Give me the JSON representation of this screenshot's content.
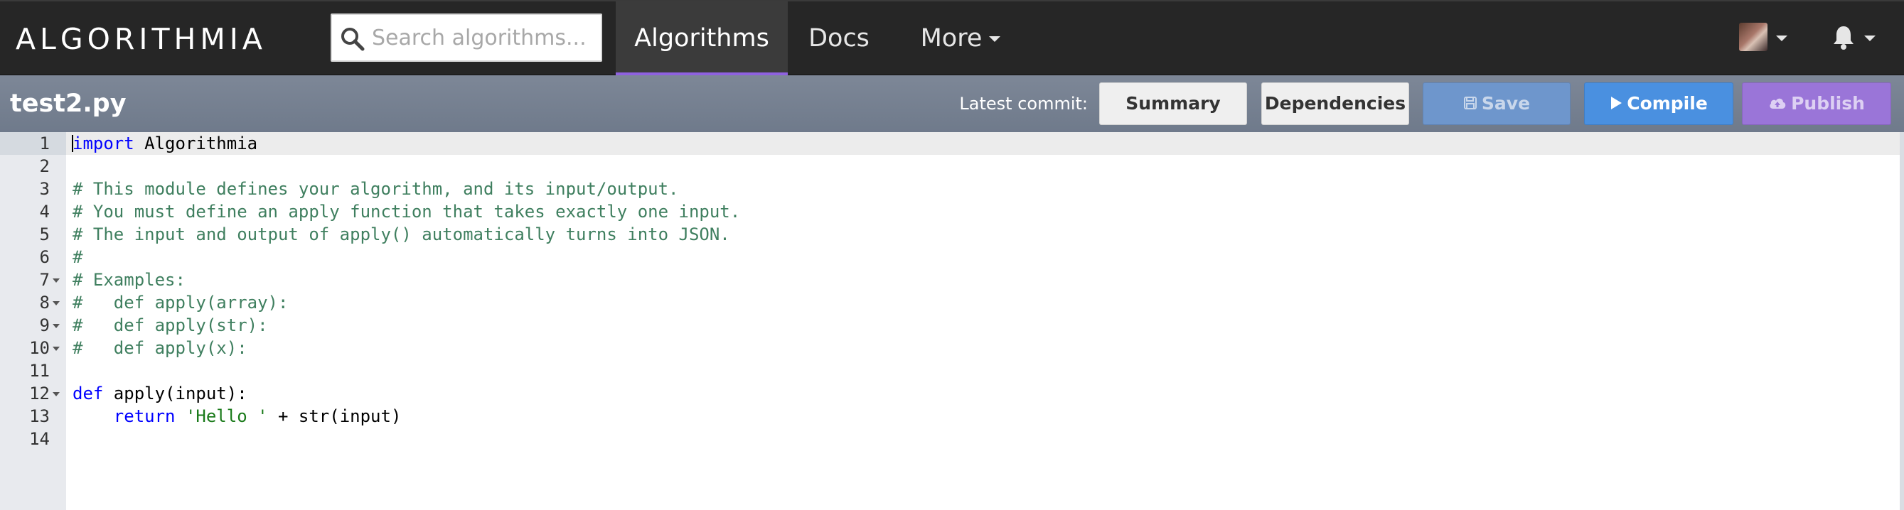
{
  "navbar": {
    "logo_text": "ALGORITHMIA",
    "search_placeholder": "Search algorithms...",
    "nav_items": [
      {
        "label": "Algorithms",
        "active": true
      },
      {
        "label": "Docs",
        "active": false
      },
      {
        "label": "More",
        "active": false
      }
    ],
    "icons": [
      "search-icon",
      "avatar",
      "bell-icon",
      "chevron-down-icon"
    ],
    "accent_color": "#8f62e0"
  },
  "toolbar": {
    "filename": "test2.py",
    "commit_label": "Latest commit:",
    "summary_label": "Summary",
    "dependencies_label": "Dependencies",
    "save_label": "Save",
    "compile_label": "Compile",
    "publish_label": "Publish",
    "colors": {
      "save": "#6e96cc",
      "compile": "#4a90e0",
      "publish": "#9a75d8"
    }
  },
  "editor": {
    "lines": [
      {
        "num": "1",
        "fold": false,
        "tokens": [
          {
            "t": "import",
            "c": "kw"
          },
          {
            "t": " Algorithmia",
            "c": ""
          }
        ]
      },
      {
        "num": "2",
        "fold": false,
        "tokens": []
      },
      {
        "num": "3",
        "fold": false,
        "tokens": [
          {
            "t": "# This module defines your algorithm, and its input/output.",
            "c": "cm"
          }
        ]
      },
      {
        "num": "4",
        "fold": false,
        "tokens": [
          {
            "t": "# You must define an apply function that takes exactly one input.",
            "c": "cm"
          }
        ]
      },
      {
        "num": "5",
        "fold": false,
        "tokens": [
          {
            "t": "# The input and output of apply() automatically turns into JSON.",
            "c": "cm"
          }
        ]
      },
      {
        "num": "6",
        "fold": false,
        "tokens": [
          {
            "t": "#",
            "c": "cm"
          }
        ]
      },
      {
        "num": "7",
        "fold": true,
        "tokens": [
          {
            "t": "# Examples:",
            "c": "cm"
          }
        ]
      },
      {
        "num": "8",
        "fold": true,
        "tokens": [
          {
            "t": "#   def apply(array):",
            "c": "cm"
          }
        ]
      },
      {
        "num": "9",
        "fold": true,
        "tokens": [
          {
            "t": "#   def apply(str):",
            "c": "cm"
          }
        ]
      },
      {
        "num": "10",
        "fold": true,
        "tokens": [
          {
            "t": "#   def apply(x):",
            "c": "cm"
          }
        ]
      },
      {
        "num": "11",
        "fold": false,
        "tokens": []
      },
      {
        "num": "12",
        "fold": true,
        "tokens": [
          {
            "t": "def",
            "c": "kw"
          },
          {
            "t": " apply(input):",
            "c": ""
          }
        ]
      },
      {
        "num": "13",
        "fold": false,
        "tokens": [
          {
            "t": "    ",
            "c": ""
          },
          {
            "t": "return",
            "c": "kw"
          },
          {
            "t": " ",
            "c": ""
          },
          {
            "t": "'Hello '",
            "c": "str"
          },
          {
            "t": " + str(input)",
            "c": ""
          }
        ]
      },
      {
        "num": "14",
        "fold": false,
        "tokens": []
      }
    ]
  }
}
